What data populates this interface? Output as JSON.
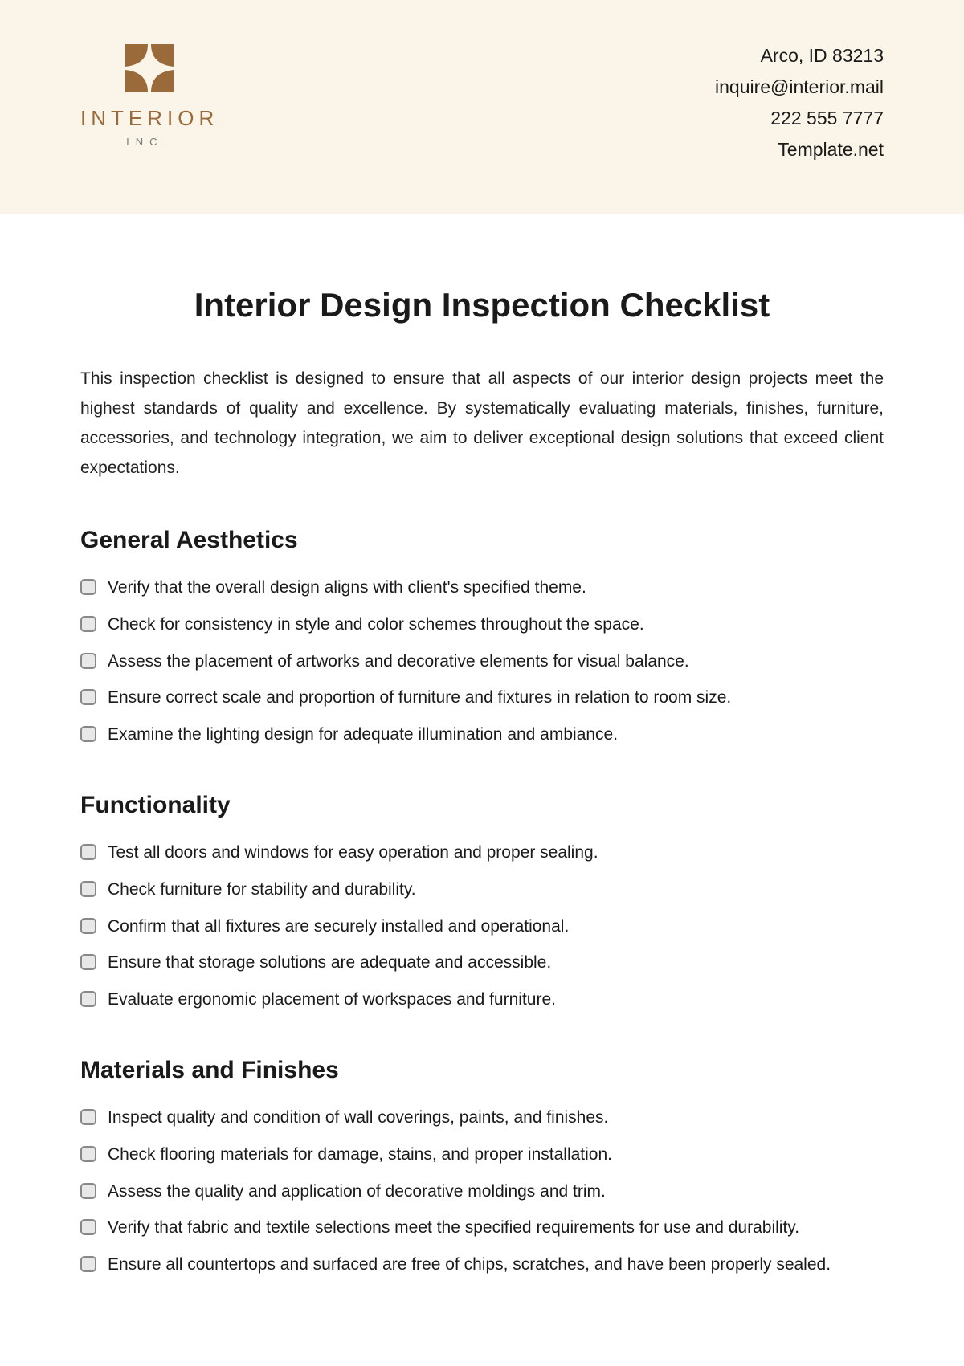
{
  "header": {
    "logo_name": "INTERIOR",
    "logo_sub": "INC.",
    "contact": {
      "address": "Arco, ID 83213",
      "email": "inquire@interior.mail",
      "phone": "222 555 7777",
      "site": "Template.net"
    }
  },
  "title": "Interior Design Inspection Checklist",
  "intro": "This inspection checklist is designed to ensure that all aspects of our interior design projects meet the highest standards of quality and excellence. By systematically evaluating materials, finishes, furniture, accessories, and technology integration, we aim to deliver exceptional design solutions that exceed client expectations.",
  "sections": [
    {
      "title": "General Aesthetics",
      "items": [
        "Verify that the overall design aligns with client's specified theme.",
        "Check for consistency in style and color schemes throughout the space.",
        "Assess the placement of artworks and decorative elements for visual balance.",
        "Ensure correct scale and proportion of furniture and fixtures in relation to room size.",
        "Examine the lighting design for adequate illumination and ambiance."
      ]
    },
    {
      "title": "Functionality",
      "items": [
        "Test all doors and windows for easy operation and proper sealing.",
        "Check furniture for stability and durability.",
        "Confirm that all fixtures are securely installed and operational.",
        "Ensure that storage solutions are adequate and accessible.",
        "Evaluate ergonomic placement of workspaces and furniture."
      ]
    },
    {
      "title": "Materials and Finishes",
      "items": [
        "Inspect quality and condition of wall coverings, paints, and finishes.",
        "Check flooring materials for damage, stains, and proper installation.",
        "Assess the quality and application of decorative moldings and trim.",
        "Verify that fabric and textile selections meet the specified requirements for use and durability.",
        "Ensure all countertops and surfaced are free of chips, scratches, and have been properly sealed."
      ]
    }
  ]
}
